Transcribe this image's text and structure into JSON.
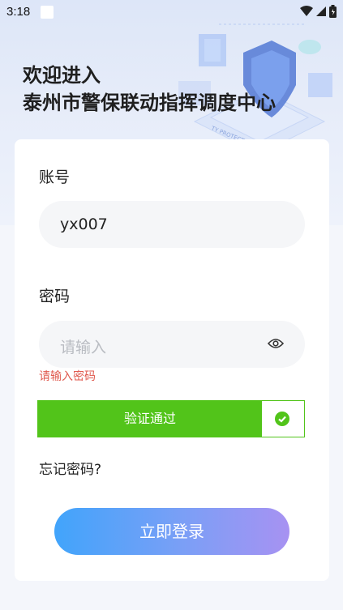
{
  "status_bar": {
    "time": "3:18"
  },
  "header": {
    "welcome_line1": "欢迎进入",
    "welcome_line2": "泰州市警保联动指挥调度中心",
    "art_caption": "TY PROTECTION"
  },
  "form": {
    "account_label": "账号",
    "account_value": "yx007",
    "password_label": "密码",
    "password_placeholder": "请输入",
    "password_error": "请输入密码",
    "verify_text": "验证通过",
    "forgot_password": "忘记密码?",
    "login_button": "立即登录"
  },
  "colors": {
    "success": "#52c41a",
    "error": "#e05a4f",
    "button_gradient_start": "#41a4fb",
    "button_gradient_end": "#a792f2"
  }
}
